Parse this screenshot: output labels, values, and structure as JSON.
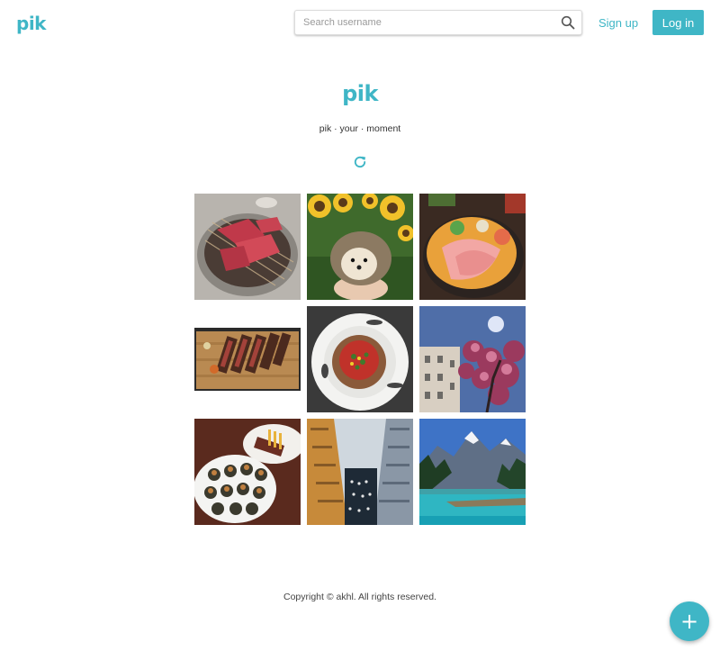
{
  "header": {
    "logo_text": "pik",
    "search": {
      "placeholder": "Search username",
      "value": ""
    },
    "signup_label": "Sign up",
    "login_label": "Log in"
  },
  "hero": {
    "title": "pik",
    "tagline": "pik · your · moment"
  },
  "icons": {
    "search": "search-icon",
    "refresh": "refresh-icon",
    "add": "plus-icon"
  },
  "colors": {
    "accent": "#3fb6c6"
  },
  "gallery": [
    {
      "name": "photo-grilled-meat"
    },
    {
      "name": "photo-hedgehog-sunflowers"
    },
    {
      "name": "photo-sashimi-bowl"
    },
    {
      "name": "photo-sliced-steak"
    },
    {
      "name": "photo-pasta-plate"
    },
    {
      "name": "photo-cherry-blossom-building"
    },
    {
      "name": "photo-escargot-plates"
    },
    {
      "name": "photo-atrium-interior"
    },
    {
      "name": "photo-mountain-lake"
    }
  ],
  "footer": {
    "copyright": "Copyright © akhl. All rights reserved."
  },
  "fab_label": "+"
}
